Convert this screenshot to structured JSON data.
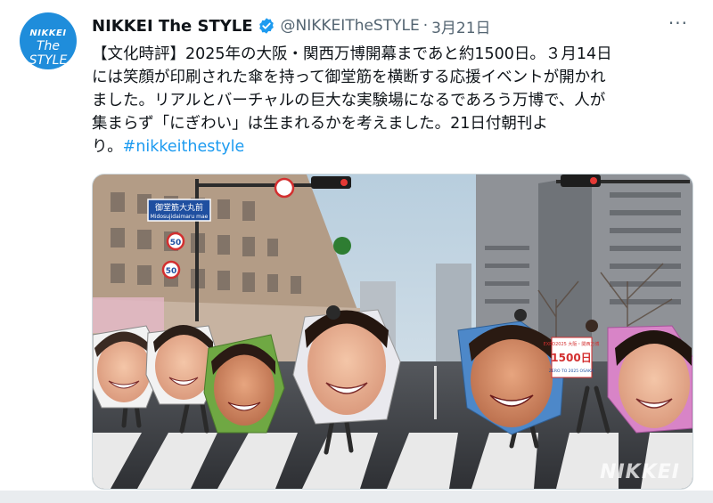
{
  "tweet": {
    "author_name": "NIKKEI The STYLE",
    "author_handle": "@NIKKEITheSTYLE",
    "separator": "·",
    "date": "3月21日",
    "avatar_line1": "NIKKEI",
    "avatar_line2": "The STYLE",
    "text_line1": "【文化時評】2025年の大阪・関西万博開幕まであと約1500日。３月14日",
    "text_line2": "には笑顔が印刷された傘を持って御堂筋を横断する応援イベントが開かれ",
    "text_line3": "ました。リアルとバーチャルの巨大な実験場になるであろう万博で、人が",
    "text_line4": "集まらず「にぎわい」は生まれるかを考えました。21日付朝刊よ",
    "text_line5": "り。",
    "hashtag": "#nikkeithestyle"
  },
  "photo": {
    "sign_name": "御堂筋大丸前",
    "sign_romaji": "Midosujidaimaru mae",
    "speed_limit": "50",
    "banner_number": "1500日",
    "banner_top": "EXPO2025 大阪・関西万博",
    "banner_bottom": "ZERO TO 2025 OSAKA",
    "watermark": "NIKKEI",
    "colors": {
      "sky": "#c9d9e6",
      "road": "#3a3d42",
      "crosswalk": "#e8e8e8",
      "building_left": "#b9a38e",
      "building_right": "#8e9196"
    }
  },
  "icons": {
    "verified": "verified-badge-icon",
    "more": "more-options-icon"
  },
  "colors": {
    "link": "#1d9bf0",
    "muted": "#536471",
    "avatar_bg": "#1f8ddb"
  }
}
